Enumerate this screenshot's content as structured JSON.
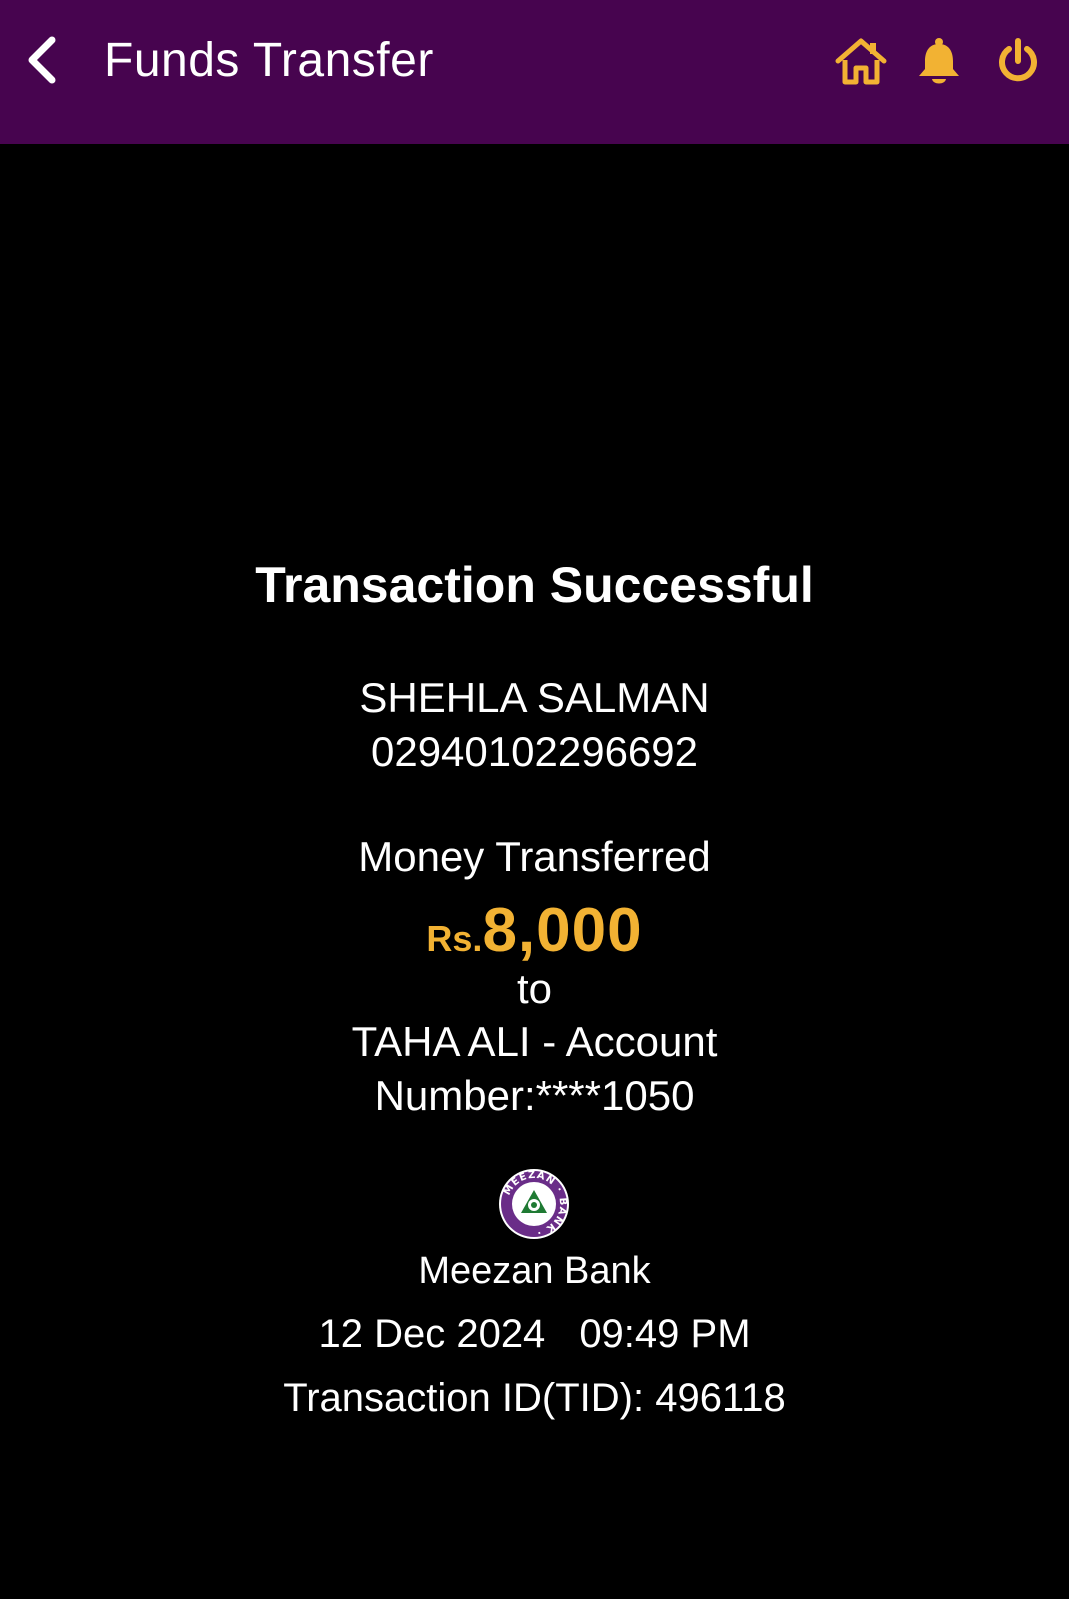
{
  "header": {
    "title": "Funds Transfer",
    "icons": [
      "back-chevron-icon",
      "home-icon",
      "bell-icon",
      "power-icon"
    ],
    "background_color": "#47044f",
    "icon_color": "#f2b233"
  },
  "receipt": {
    "status_title": "Transaction Successful",
    "sender_name": "SHEHLA SALMAN",
    "sender_account": "02940102296692",
    "money_label": "Money Transferred",
    "currency": "Rs.",
    "amount": "8,000",
    "amount_color": "#f2b233",
    "to_label": "to",
    "beneficiary_line1": "TAHA ALI  - Account",
    "beneficiary_line2": "Number:****1050",
    "bank_name": "Meezan Bank",
    "bank_logo_text": "MEEZAN BANK",
    "date": "12 Dec 2024",
    "time": "09:49 PM",
    "transaction_id_label": "Transaction ID(TID):",
    "transaction_id": "496118"
  }
}
